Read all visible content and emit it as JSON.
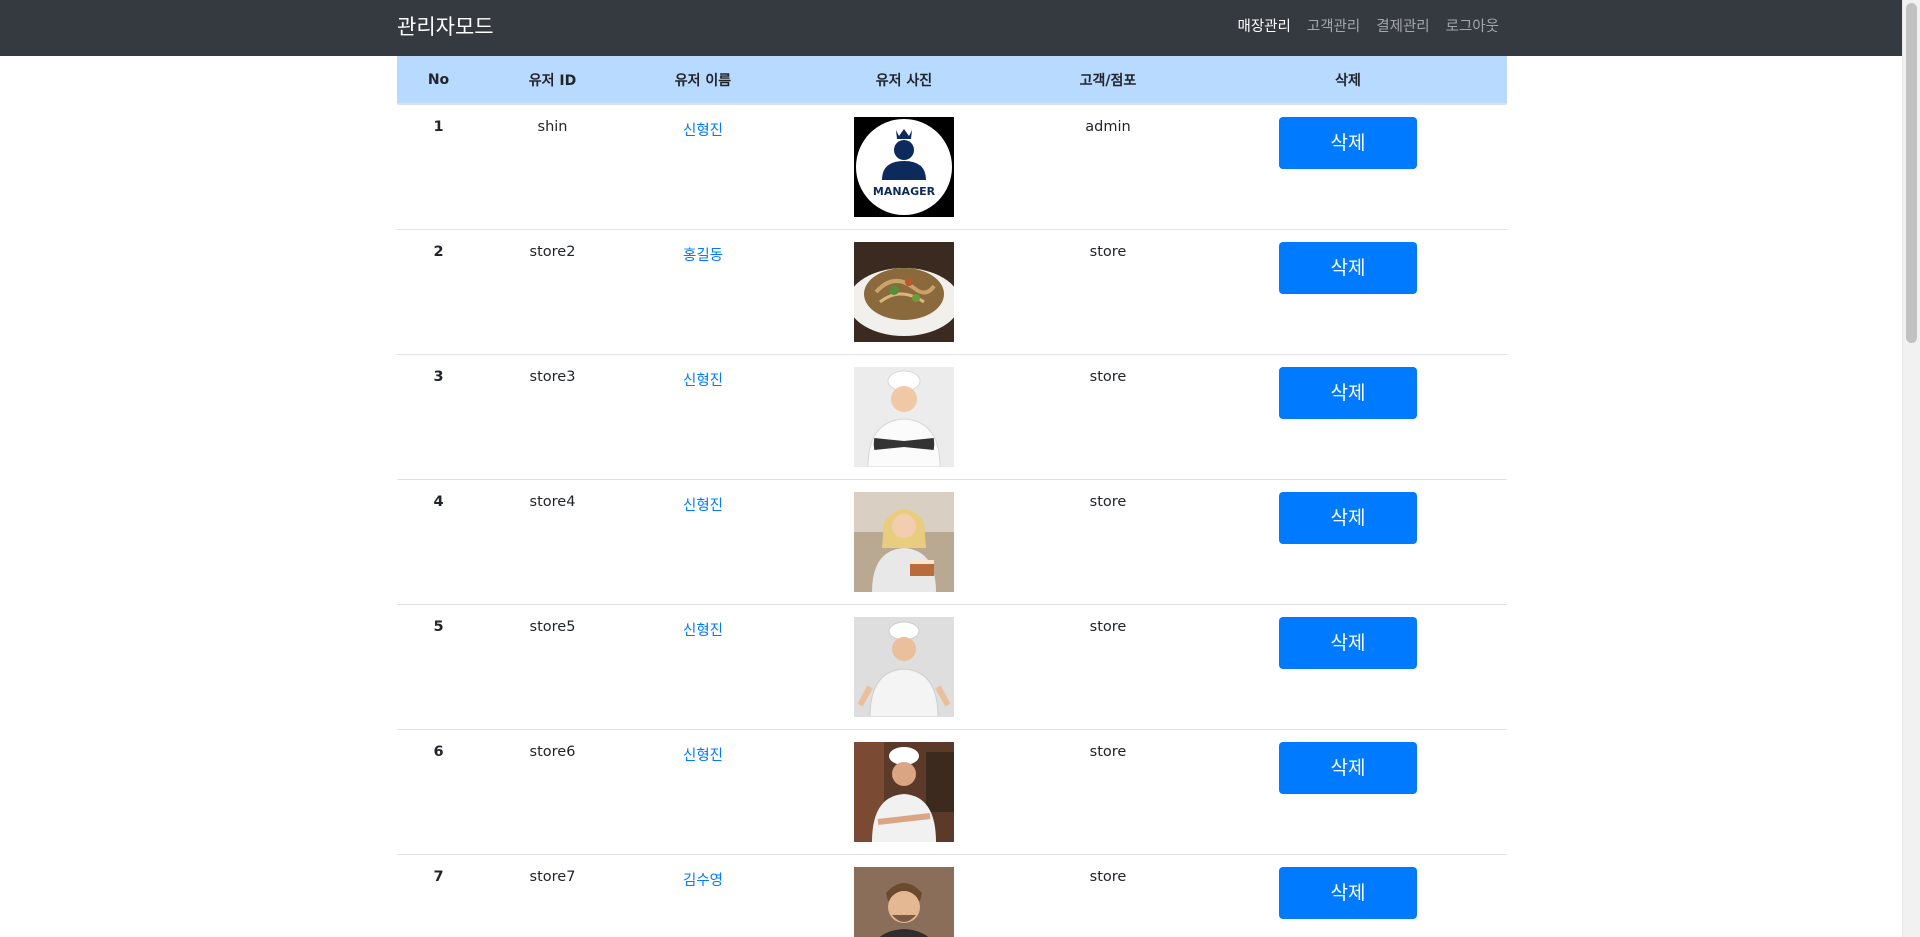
{
  "navbar": {
    "brand": "관리자모드",
    "links": [
      "매장관리",
      "고객관리",
      "결제관리",
      "로그아웃"
    ]
  },
  "table": {
    "headers": [
      "No",
      "유저 ID",
      "유저 이름",
      "유저 사진",
      "고객/점포",
      "삭제"
    ],
    "delete_label": "삭제",
    "rows": [
      {
        "no": "1",
        "user_id": "shin",
        "name": "신형진",
        "photo": "manager-logo-icon",
        "type": "admin"
      },
      {
        "no": "2",
        "user_id": "store2",
        "name": "홍길동",
        "photo": "food-plate-photo",
        "type": "store"
      },
      {
        "no": "3",
        "user_id": "store3",
        "name": "신형진",
        "photo": "chef-woman-photo",
        "type": "store"
      },
      {
        "no": "4",
        "user_id": "store4",
        "name": "신형진",
        "photo": "baker-woman-photo",
        "type": "store"
      },
      {
        "no": "5",
        "user_id": "store5",
        "name": "신형진",
        "photo": "chef-man-photo",
        "type": "store"
      },
      {
        "no": "6",
        "user_id": "store6",
        "name": "신형진",
        "photo": "chef-man-kitchen-photo",
        "type": "store"
      },
      {
        "no": "7",
        "user_id": "store7",
        "name": "김수영",
        "photo": "smiling-man-photo",
        "type": "store"
      }
    ]
  },
  "colors": {
    "navbar": "#343a40",
    "header_row": "#b8daff",
    "primary": "#007bff"
  },
  "manager_logo_text": "MANAGER"
}
